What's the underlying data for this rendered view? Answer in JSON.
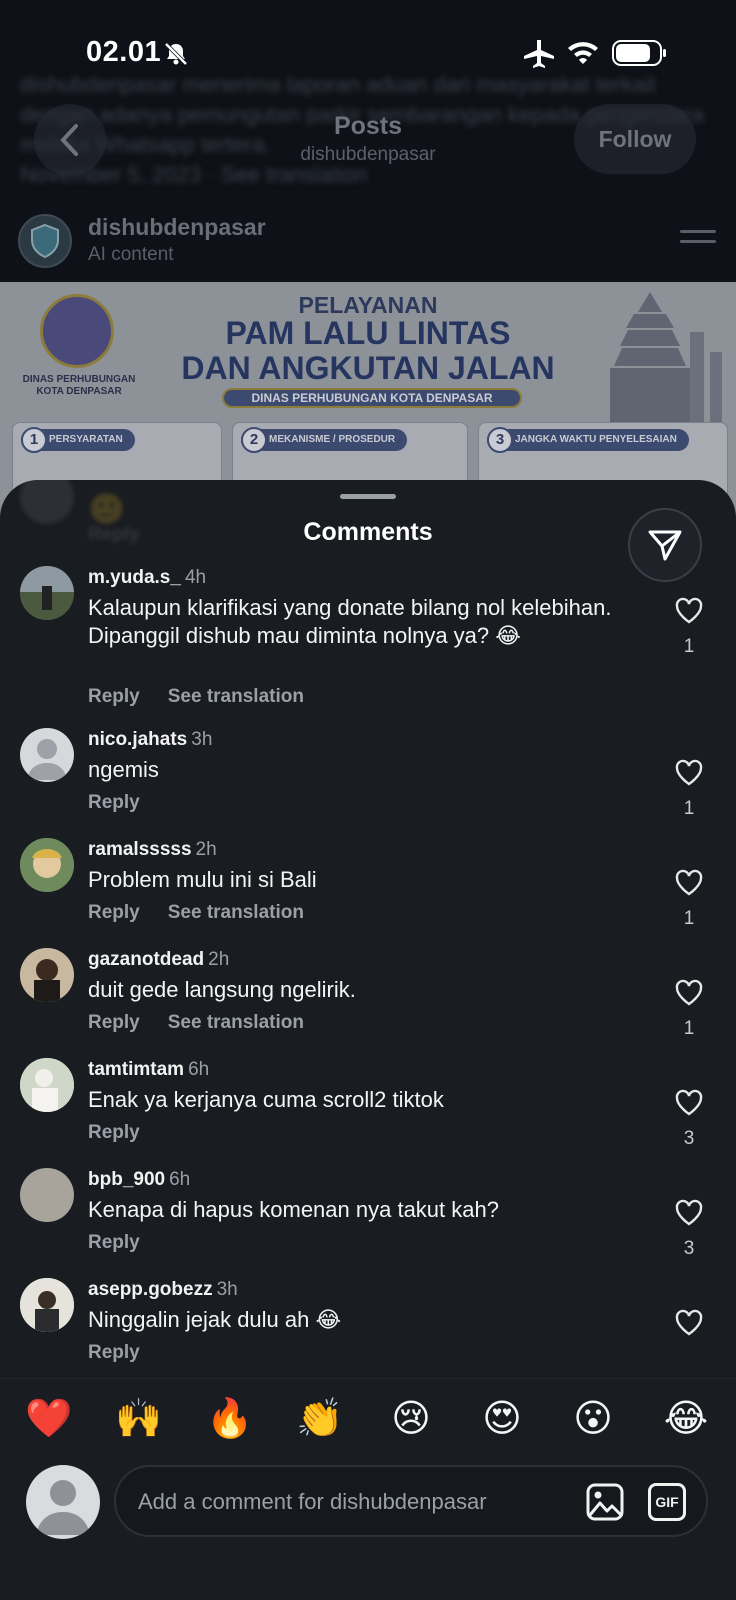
{
  "status_bar": {
    "time": "02.01"
  },
  "background_post": {
    "blurred_caption": "dishubdenpasar menerima laporan aduan dari masyarakat terkait dengan adanya pemungutan parkir sembarangan kepada pengendara melalui Whatsapp tertera.",
    "blurred_date": "November 5, 2023 · See translation",
    "header": {
      "title": "Posts",
      "subtitle": "dishubdenpasar",
      "follow_label": "Follow"
    },
    "author": {
      "name": "dishubdenpasar",
      "label": "AI content"
    },
    "banner": {
      "logo_text": "DINAS PERHUBUNGAN KOTA DENPASAR",
      "line1": "PELAYANAN",
      "line2": "PAM LALU LINTAS",
      "line3": "DAN ANGKUTAN JALAN",
      "pill": "DINAS PERHUBUNGAN KOTA DENPASAR",
      "cards": [
        {
          "num": "1",
          "label": "PERSYARATAN"
        },
        {
          "num": "2",
          "label": "MEKANISME / PROSEDUR"
        },
        {
          "num": "3",
          "label": "JANGKA WAKTU PENYELESAIAN"
        }
      ]
    }
  },
  "sheet": {
    "title": "Comments",
    "ghost_reply": "Reply",
    "comments": [
      {
        "user": "m.yuda.s_",
        "time": "4h",
        "text": "Kalaupun klarifikasi yang donate bilang nol kelebihan. Dipanggil dishub mau diminta nolnya ya? 😂",
        "reply": "Reply",
        "translate": "See translation",
        "likes": "1"
      },
      {
        "user": "nico.jahats",
        "time": "3h",
        "text": "ngemis",
        "reply": "Reply",
        "translate": "",
        "likes": "1"
      },
      {
        "user": "ramalsssss",
        "time": "2h",
        "text": "Problem mulu ini si Bali",
        "reply": "Reply",
        "translate": "See translation",
        "likes": "1"
      },
      {
        "user": "gazanotdead",
        "time": "2h",
        "text": "duit gede langsung ngelirik.",
        "reply": "Reply",
        "translate": "See translation",
        "likes": "1"
      },
      {
        "user": "tamtimtam",
        "time": "6h",
        "text": "Enak ya kerjanya cuma scroll2 tiktok",
        "reply": "Reply",
        "translate": "",
        "likes": "3"
      },
      {
        "user": "bpb_900",
        "time": "6h",
        "text": "Kenapa di hapus komenan nya takut kah?",
        "reply": "Reply",
        "translate": "",
        "likes": "3"
      },
      {
        "user": "asepp.gobezz",
        "time": "3h",
        "text": "Ninggalin jejak dulu ah 😂",
        "reply": "Reply",
        "translate": "",
        "likes": ""
      }
    ]
  },
  "bottom_bar": {
    "emojis": [
      "❤️",
      "🙌",
      "🔥",
      "👏",
      "😢",
      "😍",
      "😮",
      "😂"
    ],
    "placeholder": "Add a comment for dishubdenpasar",
    "gif_label": "GIF"
  },
  "colors": {
    "sheet_bg": "#191c21",
    "text_primary": "#f4f4f4",
    "text_secondary": "#9ba0a8"
  }
}
